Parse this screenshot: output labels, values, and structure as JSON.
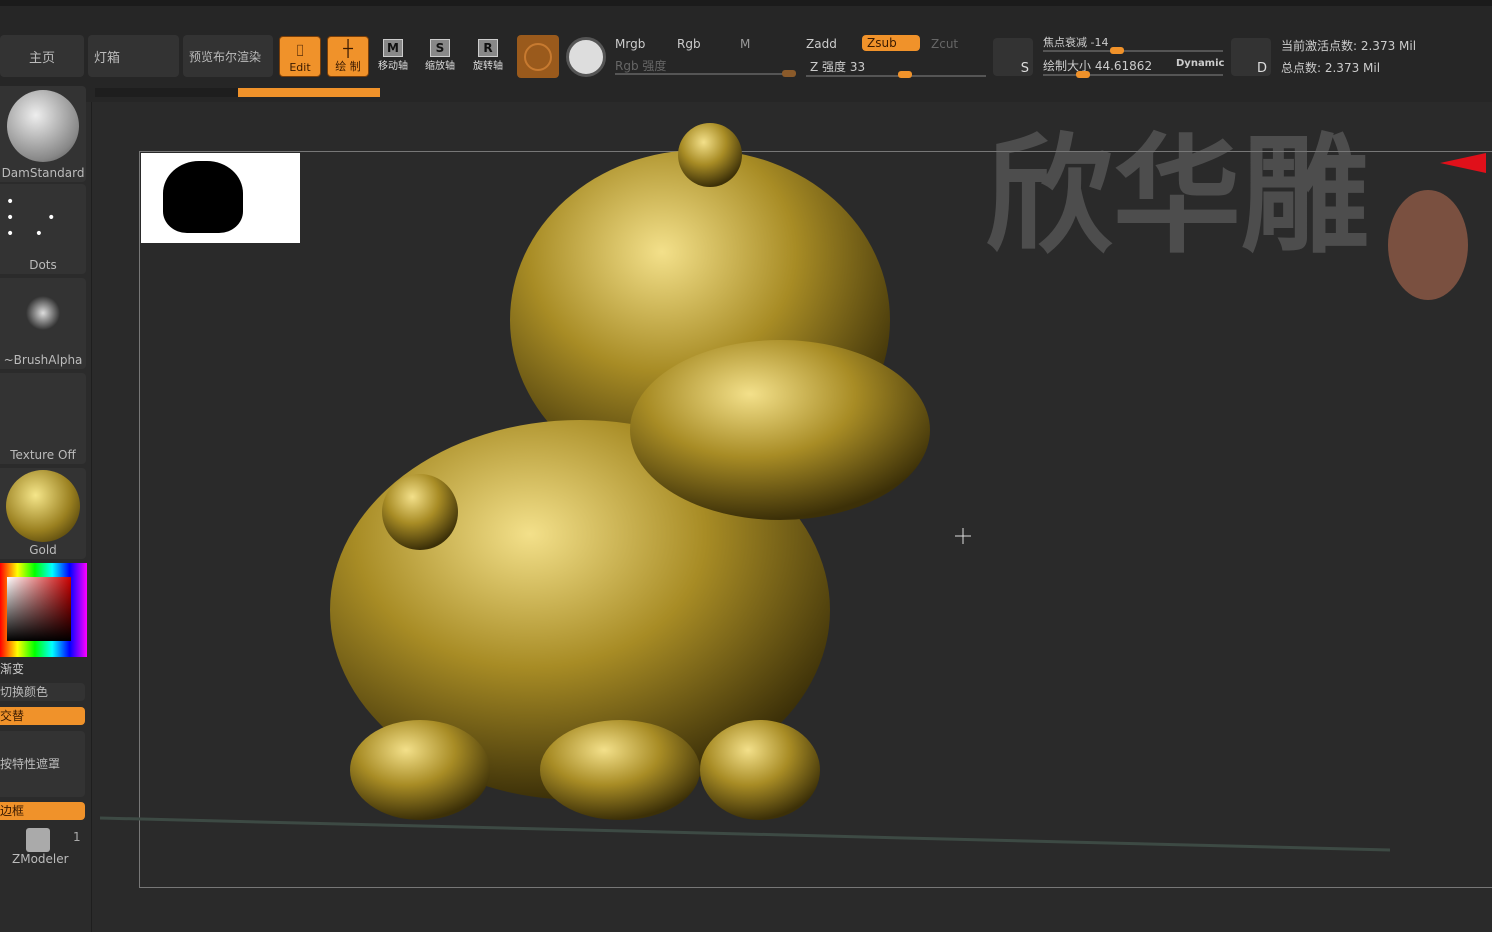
{
  "toolbar": {
    "home": "主页",
    "lightbox": "灯箱",
    "bool_preview": "预览布尔渲染",
    "edit": "Edit",
    "draw": "绘 制",
    "move": "移动轴",
    "scale": "缩放轴",
    "rotate": "旋转轴",
    "move_key": "M",
    "scale_key": "S",
    "rotate_key": "R"
  },
  "color_modes": {
    "mrgb": "Mrgb",
    "rgb": "Rgb",
    "m": "M",
    "rgb_intensity": "Rgb 强度"
  },
  "z_modes": {
    "zadd": "Zadd",
    "zsub": "Zsub",
    "zcut": "Zcut",
    "z_intensity": "Z 强度 33",
    "z_intensity_value": 33
  },
  "brush": {
    "focal_shift": "焦点衰减 -14",
    "draw_size": "绘制大小 44.61862",
    "dynamic": "Dynamic",
    "s_label": "S",
    "d_label": "D"
  },
  "stats": {
    "active_points": "当前激活点数: 2.373 Mil",
    "total_points": "总点数: 2.373 Mil"
  },
  "left": {
    "brush": "DamStandard",
    "stroke": "Dots",
    "alpha": "~BrushAlpha",
    "texture": "Texture Off",
    "material": "Gold",
    "gradient": "渐变",
    "switch_color": "切换颜色",
    "alternate": "交替",
    "mask_by_feature": "按特性遮罩",
    "frame": "边框",
    "zmodeler": "ZModeler",
    "zmodeler_count": "1"
  },
  "watermark": "欣华雕",
  "colors": {
    "accent": "#f0922a",
    "gold": "#b8a030"
  }
}
